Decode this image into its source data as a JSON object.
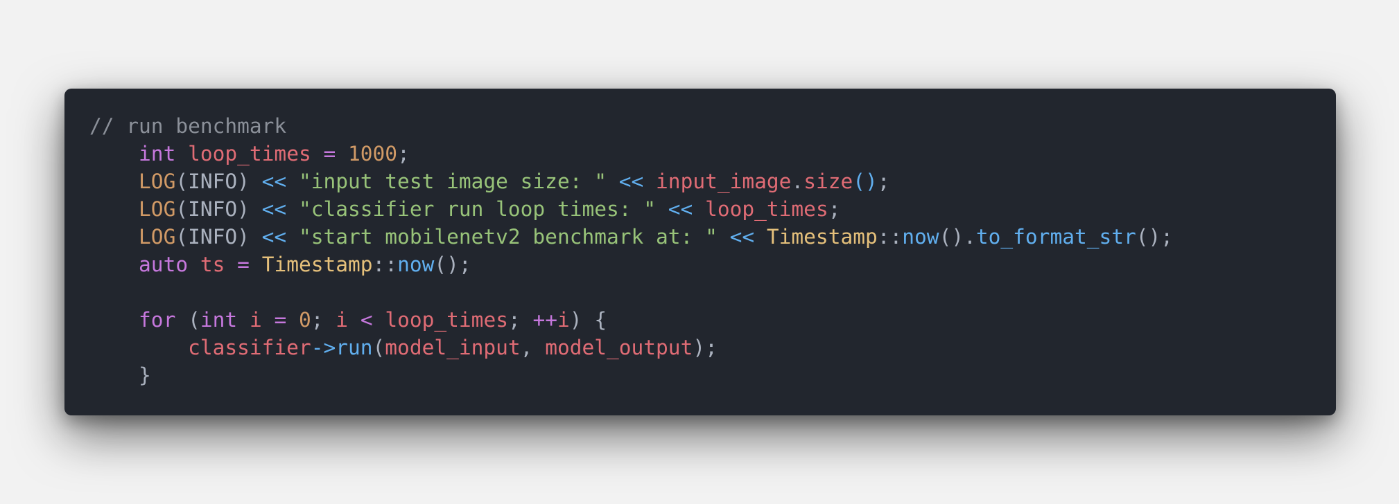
{
  "code_block": {
    "language": "cpp",
    "lines": [
      [
        {
          "t": "// run benchmark",
          "k": "comment"
        }
      ],
      [
        {
          "t": "    ",
          "k": "plain"
        },
        {
          "t": "int",
          "k": "keyword"
        },
        {
          "t": " ",
          "k": "plain"
        },
        {
          "t": "loop_times",
          "k": "variable"
        },
        {
          "t": " ",
          "k": "plain"
        },
        {
          "t": "=",
          "k": "operator"
        },
        {
          "t": " ",
          "k": "plain"
        },
        {
          "t": "1000",
          "k": "number"
        },
        {
          "t": ";",
          "k": "plain"
        }
      ],
      [
        {
          "t": "    ",
          "k": "plain"
        },
        {
          "t": "LOG",
          "k": "macro"
        },
        {
          "t": "(INFO) ",
          "k": "plain"
        },
        {
          "t": "<<",
          "k": "stream-op"
        },
        {
          "t": " ",
          "k": "plain"
        },
        {
          "t": "\"input test image size: \"",
          "k": "string"
        },
        {
          "t": " ",
          "k": "plain"
        },
        {
          "t": "<<",
          "k": "stream-op"
        },
        {
          "t": " ",
          "k": "plain"
        },
        {
          "t": "input_image",
          "k": "variable"
        },
        {
          "t": ".",
          "k": "plain"
        },
        {
          "t": "size",
          "k": "variable"
        },
        {
          "t": "()",
          "k": "function"
        },
        {
          "t": ";",
          "k": "plain"
        }
      ],
      [
        {
          "t": "    ",
          "k": "plain"
        },
        {
          "t": "LOG",
          "k": "macro"
        },
        {
          "t": "(INFO) ",
          "k": "plain"
        },
        {
          "t": "<<",
          "k": "stream-op"
        },
        {
          "t": " ",
          "k": "plain"
        },
        {
          "t": "\"classifier run loop times: \"",
          "k": "string"
        },
        {
          "t": " ",
          "k": "plain"
        },
        {
          "t": "<<",
          "k": "stream-op"
        },
        {
          "t": " ",
          "k": "plain"
        },
        {
          "t": "loop_times",
          "k": "variable"
        },
        {
          "t": ";",
          "k": "plain"
        }
      ],
      [
        {
          "t": "    ",
          "k": "plain"
        },
        {
          "t": "LOG",
          "k": "macro"
        },
        {
          "t": "(INFO) ",
          "k": "plain"
        },
        {
          "t": "<<",
          "k": "stream-op"
        },
        {
          "t": " ",
          "k": "plain"
        },
        {
          "t": "\"start mobilenetv2 benchmark at: \"",
          "k": "string"
        },
        {
          "t": " ",
          "k": "plain"
        },
        {
          "t": "<<",
          "k": "stream-op"
        },
        {
          "t": " ",
          "k": "plain"
        },
        {
          "t": "Timestamp",
          "k": "class"
        },
        {
          "t": "::",
          "k": "scope"
        },
        {
          "t": "now",
          "k": "function"
        },
        {
          "t": "().",
          "k": "plain"
        },
        {
          "t": "to_format_str",
          "k": "function"
        },
        {
          "t": "();",
          "k": "plain"
        }
      ],
      [
        {
          "t": "    ",
          "k": "plain"
        },
        {
          "t": "auto",
          "k": "keyword"
        },
        {
          "t": " ",
          "k": "plain"
        },
        {
          "t": "ts",
          "k": "variable"
        },
        {
          "t": " ",
          "k": "plain"
        },
        {
          "t": "=",
          "k": "operator"
        },
        {
          "t": " ",
          "k": "plain"
        },
        {
          "t": "Timestamp",
          "k": "class"
        },
        {
          "t": "::",
          "k": "scope"
        },
        {
          "t": "now",
          "k": "function"
        },
        {
          "t": "();",
          "k": "plain"
        }
      ],
      [
        {
          "t": "",
          "k": "plain"
        }
      ],
      [
        {
          "t": "    ",
          "k": "plain"
        },
        {
          "t": "for",
          "k": "keyword"
        },
        {
          "t": " (",
          "k": "plain"
        },
        {
          "t": "int",
          "k": "keyword"
        },
        {
          "t": " ",
          "k": "plain"
        },
        {
          "t": "i",
          "k": "variable"
        },
        {
          "t": " ",
          "k": "plain"
        },
        {
          "t": "=",
          "k": "operator"
        },
        {
          "t": " ",
          "k": "plain"
        },
        {
          "t": "0",
          "k": "number"
        },
        {
          "t": "; ",
          "k": "plain"
        },
        {
          "t": "i",
          "k": "variable"
        },
        {
          "t": " ",
          "k": "plain"
        },
        {
          "t": "<",
          "k": "operator"
        },
        {
          "t": " ",
          "k": "plain"
        },
        {
          "t": "loop_times",
          "k": "variable"
        },
        {
          "t": "; ",
          "k": "plain"
        },
        {
          "t": "++",
          "k": "operator"
        },
        {
          "t": "i",
          "k": "variable"
        },
        {
          "t": ") {",
          "k": "plain"
        }
      ],
      [
        {
          "t": "        ",
          "k": "plain"
        },
        {
          "t": "classifier",
          "k": "variable"
        },
        {
          "t": "->",
          "k": "stream-op"
        },
        {
          "t": "run",
          "k": "function"
        },
        {
          "t": "(",
          "k": "plain"
        },
        {
          "t": "model_input",
          "k": "variable"
        },
        {
          "t": ", ",
          "k": "plain"
        },
        {
          "t": "model_output",
          "k": "variable"
        },
        {
          "t": ");",
          "k": "plain"
        }
      ],
      [
        {
          "t": "    }",
          "k": "plain"
        }
      ]
    ]
  },
  "colors": {
    "page_background": "#f2f2f2",
    "editor_background": "#22262e",
    "comment": "#8b9099",
    "keyword": "#c678dd",
    "variable": "#e06c75",
    "string": "#98c379",
    "function": "#61afef",
    "number": "#d19a66",
    "class": "#e5c07b",
    "plain": "#abb2bf"
  }
}
